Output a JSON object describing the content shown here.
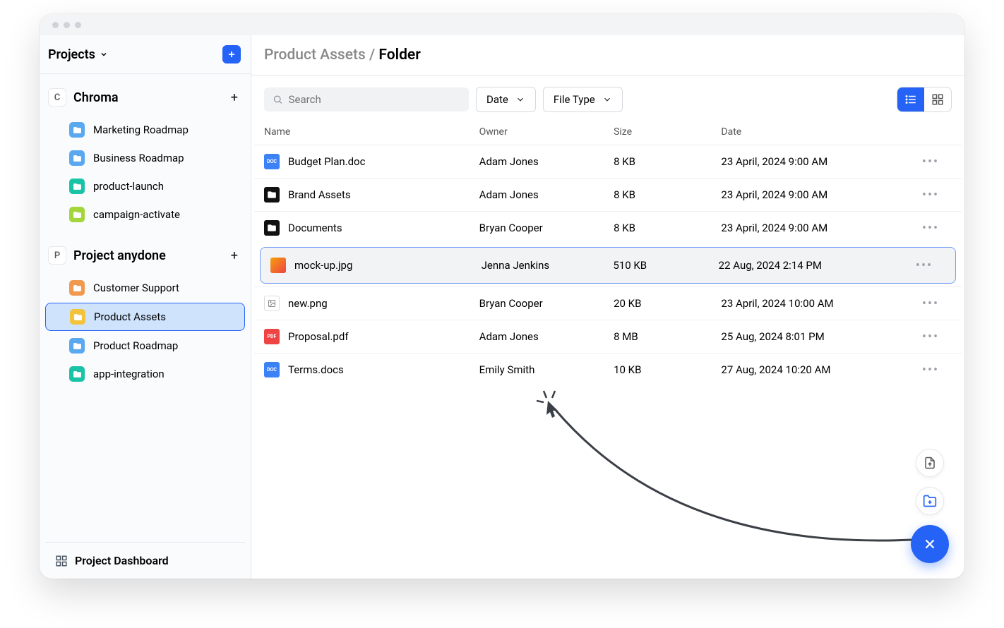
{
  "sidebar": {
    "title": "Projects",
    "add_label": "+",
    "footer_label": "Project Dashboard",
    "projects": [
      {
        "badge": "C",
        "name": "Chroma",
        "items": [
          {
            "label": "Marketing Roadmap",
            "color": "blue"
          },
          {
            "label": "Business Roadmap",
            "color": "blue"
          },
          {
            "label": "product-launch",
            "color": "teal"
          },
          {
            "label": "campaign-activate",
            "color": "lime"
          }
        ]
      },
      {
        "badge": "P",
        "name": "Project anydone",
        "items": [
          {
            "label": "Customer Support",
            "color": "orange"
          },
          {
            "label": "Product Assets",
            "color": "yellow",
            "active": true
          },
          {
            "label": "Product Roadmap",
            "color": "blue"
          },
          {
            "label": "app-integration",
            "color": "teal"
          }
        ]
      }
    ]
  },
  "breadcrumb": {
    "parent": "Product Assets",
    "sep": " / ",
    "current": "Folder"
  },
  "toolbar": {
    "search_placeholder": "Search",
    "date_label": "Date",
    "filetype_label": "File Type"
  },
  "columns": {
    "name": "Name",
    "owner": "Owner",
    "size": "Size",
    "date": "Date"
  },
  "rows": [
    {
      "name": "Budget Plan.doc",
      "owner": "Adam Jones",
      "size": "8 KB",
      "date": "23 April, 2024 9:00 AM",
      "icon": "doc"
    },
    {
      "name": "Brand Assets",
      "owner": "Adam Jones",
      "size": "8 KB",
      "date": "23 April, 2024 9:00 AM",
      "icon": "folder"
    },
    {
      "name": "Documents",
      "owner": "Bryan Cooper",
      "size": "8 KB",
      "date": "23 April, 2024 9:00 AM",
      "icon": "folder"
    },
    {
      "name": "mock-up.jpg",
      "owner": "Jenna Jenkins",
      "size": "510 KB",
      "date": "22 Aug, 2024 2:14 PM",
      "icon": "jpg",
      "selected": true
    },
    {
      "name": "new.png",
      "owner": "Bryan Cooper",
      "size": "20 KB",
      "date": "23 April, 2024 10:00 AM",
      "icon": "png"
    },
    {
      "name": "Proposal.pdf",
      "owner": "Adam Jones",
      "size": "8 MB",
      "date": "25 Aug, 2024 8:01 PM",
      "icon": "pdf"
    },
    {
      "name": "Terms.docs",
      "owner": "Emily Smith",
      "size": "10 KB",
      "date": "27 Aug, 2024 10:20 AM",
      "icon": "doc"
    }
  ]
}
